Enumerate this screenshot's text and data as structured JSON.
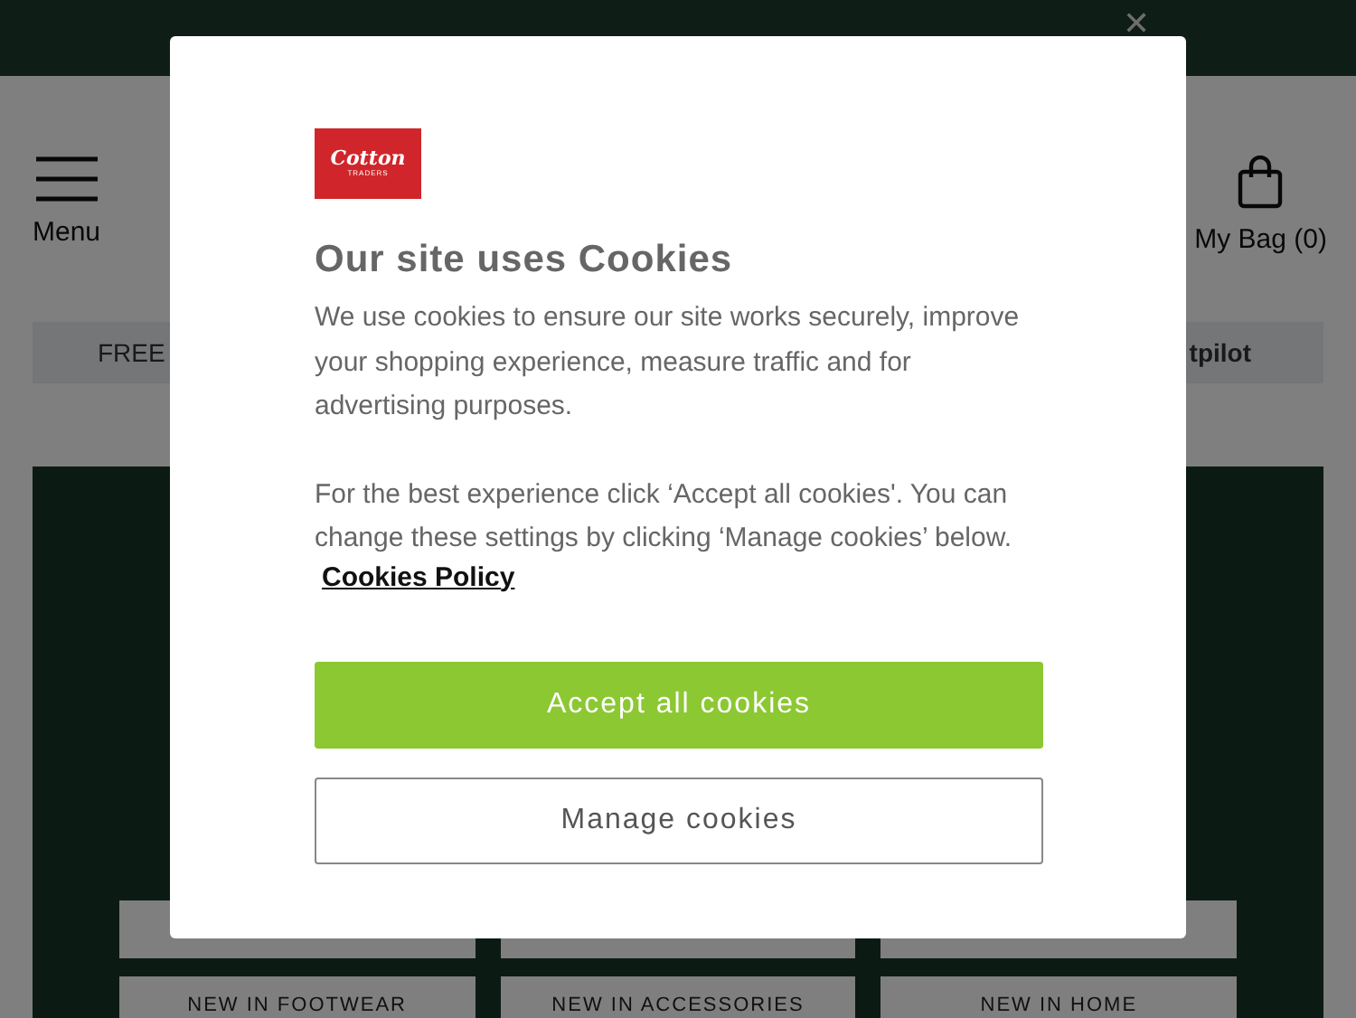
{
  "promo_banner": {
    "close": "✕"
  },
  "header": {
    "menu_label": "Menu",
    "bag_label": "My Bag (0)"
  },
  "info_strip": {
    "left_text": "FREE",
    "right_text": "tpilot"
  },
  "category_tiles": [
    {
      "kind": "blank"
    },
    {
      "kind": "blank"
    },
    {
      "kind": "blank"
    },
    {
      "kind": "labeled",
      "label": "NEW IN FOOTWEAR"
    },
    {
      "kind": "labeled",
      "label": "NEW IN ACCESSORIES"
    },
    {
      "kind": "labeled",
      "label": "NEW IN HOME"
    }
  ],
  "cookie_dialog": {
    "logo": {
      "brand": "Cotton",
      "sub": "TRADERS"
    },
    "title": "Our site uses Cookies",
    "paragraphs": [
      "We use cookies to ensure our site works securely, improve your shopping experience, measure traffic and for advertising purposes.",
      "For the best experience click ‘Accept all cookies'. You can change these settings by clicking ‘Manage cookies’ below."
    ],
    "policy_link": "Cookies Policy",
    "buttons": [
      {
        "label": "Accept all cookies",
        "kind": "primary"
      },
      {
        "label": "Manage cookies",
        "kind": "secondary"
      }
    ]
  }
}
